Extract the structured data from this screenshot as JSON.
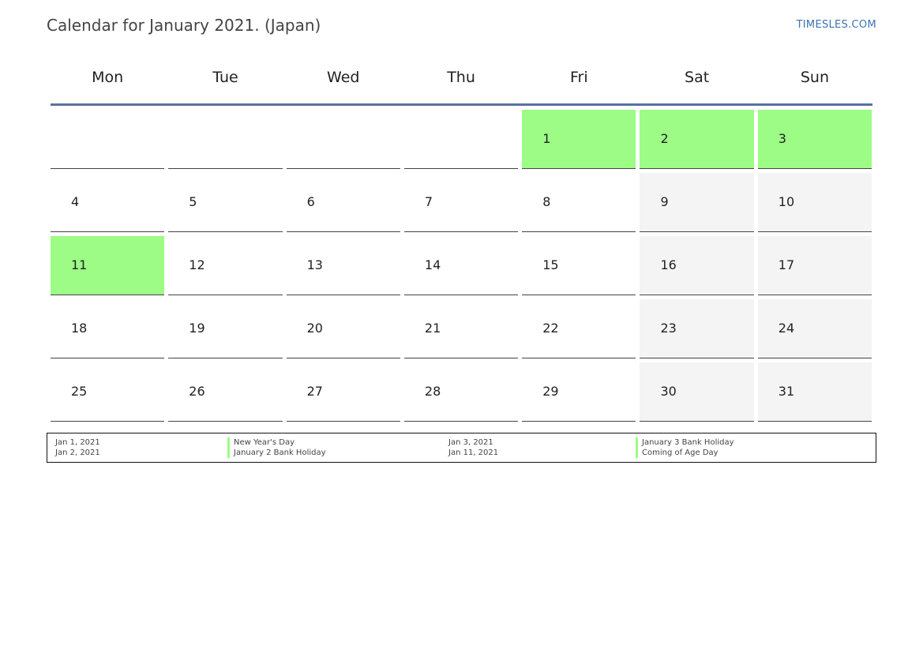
{
  "header": {
    "title": "Calendar for January 2021. (Japan)",
    "site": "TIMESLES.COM"
  },
  "calendar": {
    "weekdays": [
      "Mon",
      "Tue",
      "Wed",
      "Thu",
      "Fri",
      "Sat",
      "Sun"
    ],
    "colors": {
      "holiday": "#9cfc86",
      "weekend": "#f4f4f4",
      "header_rule": "#5a72a0"
    },
    "weeks": [
      [
        {
          "day": "",
          "type": "empty"
        },
        {
          "day": "",
          "type": "empty"
        },
        {
          "day": "",
          "type": "empty"
        },
        {
          "day": "",
          "type": "empty"
        },
        {
          "day": "1",
          "type": "holiday"
        },
        {
          "day": "2",
          "type": "holiday"
        },
        {
          "day": "3",
          "type": "holiday"
        }
      ],
      [
        {
          "day": "4",
          "type": "normal"
        },
        {
          "day": "5",
          "type": "normal"
        },
        {
          "day": "6",
          "type": "normal"
        },
        {
          "day": "7",
          "type": "normal"
        },
        {
          "day": "8",
          "type": "normal"
        },
        {
          "day": "9",
          "type": "weekend"
        },
        {
          "day": "10",
          "type": "weekend"
        }
      ],
      [
        {
          "day": "11",
          "type": "holiday"
        },
        {
          "day": "12",
          "type": "normal"
        },
        {
          "day": "13",
          "type": "normal"
        },
        {
          "day": "14",
          "type": "normal"
        },
        {
          "day": "15",
          "type": "normal"
        },
        {
          "day": "16",
          "type": "weekend"
        },
        {
          "day": "17",
          "type": "weekend"
        }
      ],
      [
        {
          "day": "18",
          "type": "normal"
        },
        {
          "day": "19",
          "type": "normal"
        },
        {
          "day": "20",
          "type": "normal"
        },
        {
          "day": "21",
          "type": "normal"
        },
        {
          "day": "22",
          "type": "normal"
        },
        {
          "day": "23",
          "type": "weekend"
        },
        {
          "day": "24",
          "type": "weekend"
        }
      ],
      [
        {
          "day": "25",
          "type": "normal"
        },
        {
          "day": "26",
          "type": "normal"
        },
        {
          "day": "27",
          "type": "normal"
        },
        {
          "day": "28",
          "type": "normal"
        },
        {
          "day": "29",
          "type": "normal"
        },
        {
          "day": "30",
          "type": "weekend"
        },
        {
          "day": "31",
          "type": "weekend"
        }
      ]
    ]
  },
  "holidays": [
    {
      "date": "Jan 1, 2021",
      "name": "New Year's Day"
    },
    {
      "date": "Jan 2, 2021",
      "name": "January 2 Bank Holiday"
    },
    {
      "date": "Jan 3, 2021",
      "name": "January 3 Bank Holiday"
    },
    {
      "date": "Jan 11, 2021",
      "name": "Coming of Age Day"
    }
  ]
}
